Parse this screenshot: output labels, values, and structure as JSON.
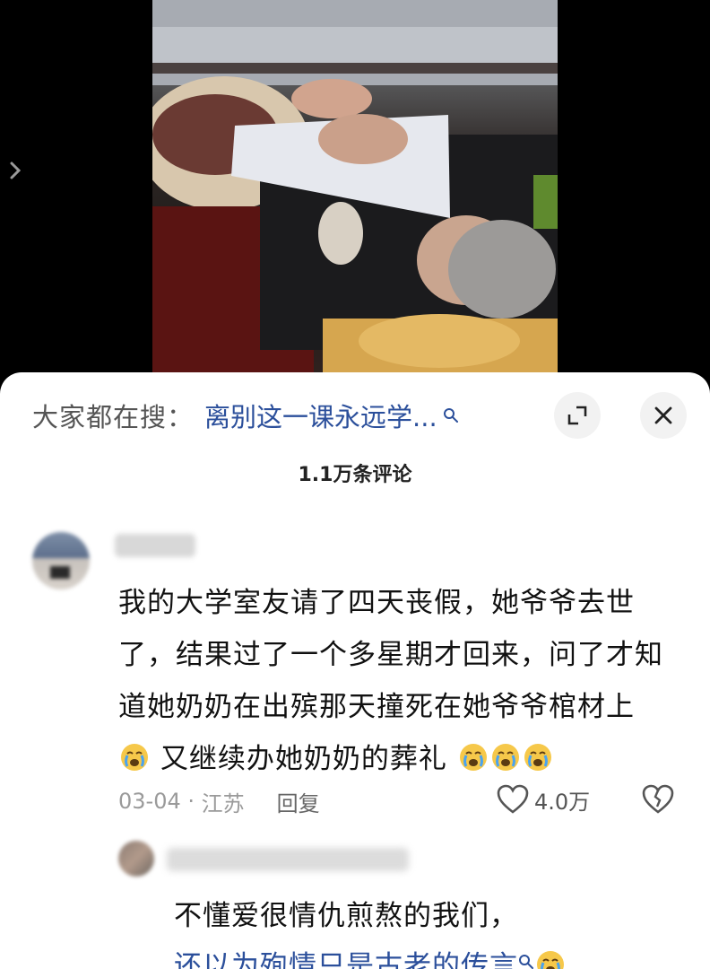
{
  "search": {
    "label": "大家都在搜：",
    "query": "离别这一课永远学..."
  },
  "comments_header": "1.1万条评论",
  "comment": {
    "text_parts": [
      "我的大学室友请了四天丧假，她爷爷去世了，结果过了一个多星期才回来，问了才知道她奶奶在出殡那天撞死在她爷爷棺材上",
      "又继续办她奶奶的葬礼"
    ],
    "date": "03-04",
    "location": "江苏",
    "reply_label": "回复",
    "like_count": "4.0万"
  },
  "reply": {
    "line1": "不懂爱很情仇煎熬的我们，",
    "link_text": "还以为殉情只是古老的传言"
  },
  "colors": {
    "link_blue": "#2b4f9b",
    "meta_gray": "#9a9a9a"
  },
  "icons": [
    "chevron-right-icon",
    "search-icon",
    "expand-icon",
    "close-icon",
    "crying-emoji-icon",
    "heart-icon",
    "broken-heart-icon"
  ]
}
